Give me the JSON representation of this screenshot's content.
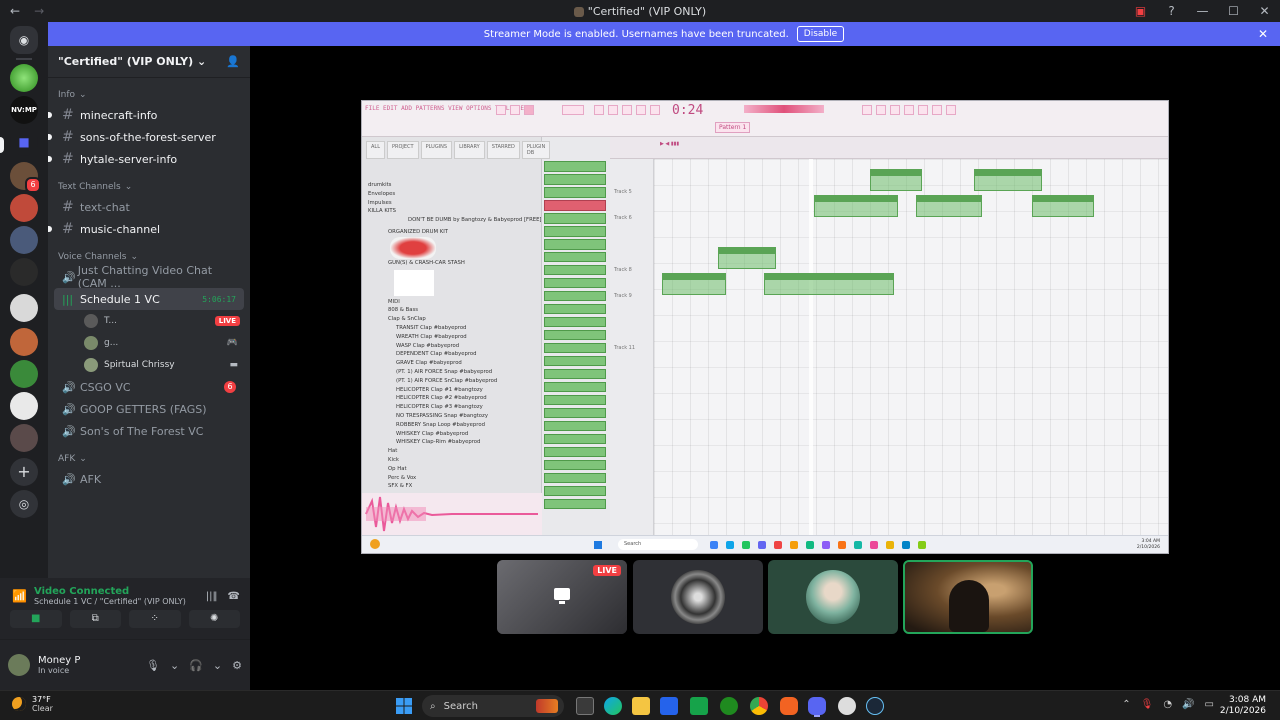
{
  "window": {
    "title": "\"Certified\" (VIP ONLY)",
    "title_icon": "server-icon"
  },
  "banner": {
    "text": "Streamer Mode is enabled. Usernames have been truncated.",
    "disable_label": "Disable"
  },
  "rail": {
    "server_label": "NV:MP"
  },
  "server": {
    "name": "\"Certified\" (VIP ONLY)"
  },
  "channels": {
    "info_category": "Info",
    "info": [
      {
        "name": "minecraft-info",
        "unread": true
      },
      {
        "name": "sons-of-the-forest-server",
        "unread": true
      },
      {
        "name": "hytale-server-info",
        "unread": true
      }
    ],
    "text_category": "Text Channels",
    "text": [
      {
        "name": "text-chat",
        "unread": false
      },
      {
        "name": "music-channel",
        "unread": true
      }
    ],
    "voice_category": "Voice Channels",
    "voice": {
      "just_chatting": "Just Chatting Video Chat (CAM ...",
      "schedule": "Schedule 1 VC",
      "schedule_time": "5:06:17",
      "users": [
        {
          "name": "T...",
          "tag": "LIVE"
        },
        {
          "name": "g...",
          "tag": ""
        },
        {
          "name": "Spirtual Chrissy",
          "tag": ""
        }
      ],
      "csgo": "CSGO VC",
      "csgo_count": "6",
      "goop": "GOOP GETTERS (FAGS)",
      "sons": "Son's of The Forest VC"
    },
    "afk_category": "AFK",
    "afk": "AFK"
  },
  "voice_panel": {
    "status": "Video Connected",
    "location": "Schedule 1 VC / \"Certified\" (VIP ONLY)"
  },
  "user": {
    "name": "Money P",
    "status": "In voice"
  },
  "stream": {
    "fl_time": "0:24",
    "pattern": "Pattern 1",
    "browser_tabs": [
      "ALL",
      "PROJECT",
      "PLUGINS",
      "LIBRARY",
      "STARRED",
      "PLUGIN DB"
    ],
    "tree": [
      "drumkits",
      "Envelopes",
      "Impulses",
      "KILLA KITS",
      "DON'T BE DUMB by Bangtozy & Babyeprod [FREE]",
      "ORGANIZED DRUM KIT",
      "GUN(S) & CRASH-CAR STASH",
      "MIDI",
      "808 & Bass",
      "Clap & SnClap",
      "TRANSIT Clap #babyeprod",
      "WREATH Clap #babyeprod",
      "WASP Clap #babyeprod",
      "DEPENDENT Clap #babyeprod",
      "GRAVE Clap #babyeprod",
      "(PT. 1) AIR FORCE Snap #babyeprod",
      "(PT. 1) AIR FORCE SnClap #babyeprod",
      "HELICOPTER Clap #1 #bangtozy",
      "HELICOPTER Clap #2 #babyeprod",
      "HELICOPTER Clap #3 #bangtozy",
      "NO TRESPASSING Snap #bangtozy",
      "ROBBERY Snap Loop #babyeprod",
      "WHISKEY Clap #babyeprod",
      "WHISKEY Clap-Rim #babyeprod",
      "Hat",
      "Kick",
      "Op Hat",
      "Perc & Vox",
      "SFX & FX"
    ],
    "track_labels": [
      "Track 5",
      "Track 6",
      "Track 8",
      "Track 9",
      "Track 11"
    ],
    "taskbar_search": "Search",
    "taskbar_clock": "3:04 AM\n2/10/2026"
  },
  "tiles": {
    "live": "LIVE"
  },
  "taskbar": {
    "temp": "37°F",
    "cond": "Clear",
    "search": "Search",
    "time": "3:08 AM",
    "date": "2/10/2026"
  }
}
